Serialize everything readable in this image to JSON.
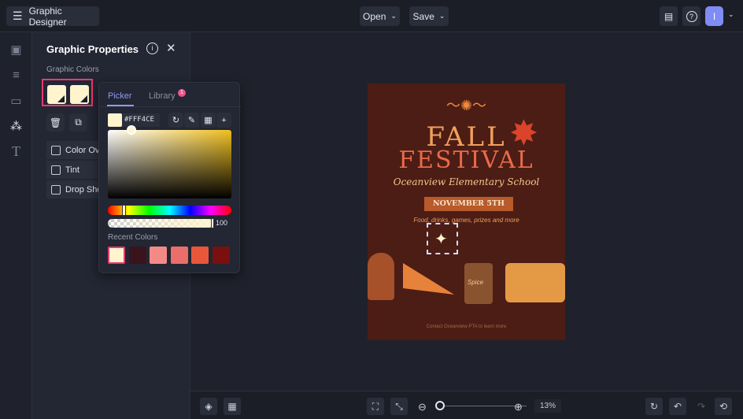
{
  "topbar": {
    "app_title": "Graphic Designer",
    "open_label": "Open",
    "save_label": "Save",
    "avatar_initial": "I"
  },
  "panel": {
    "title": "Graphic Properties",
    "colors_label": "Graphic Colors",
    "options": [
      "Color Ov",
      "Tint",
      "Drop Sho"
    ]
  },
  "picker": {
    "tab_picker": "Picker",
    "tab_library": "Library",
    "library_badge": "1",
    "hex": "#FFF4CE",
    "opacity": "100",
    "recent_label": "Recent Colors",
    "recent_colors": [
      "#fff4ce",
      "#3a141c",
      "#f48a86",
      "#ea6e6a",
      "#e9573a",
      "#7a0f0f"
    ],
    "hue_fraction": 0.13
  },
  "poster": {
    "title1": "FALL",
    "title2": "FESTIVAL",
    "school": "Oceanview Elementary School",
    "date": "NOVEMBER 5TH",
    "tagline": "Food, drinks, games, prizes and more",
    "footer": "Contact Oceanview PTA to learn more",
    "cup_text": "Spice"
  },
  "bottombar": {
    "zoom": "13%",
    "zoom_fraction": 0.0
  }
}
